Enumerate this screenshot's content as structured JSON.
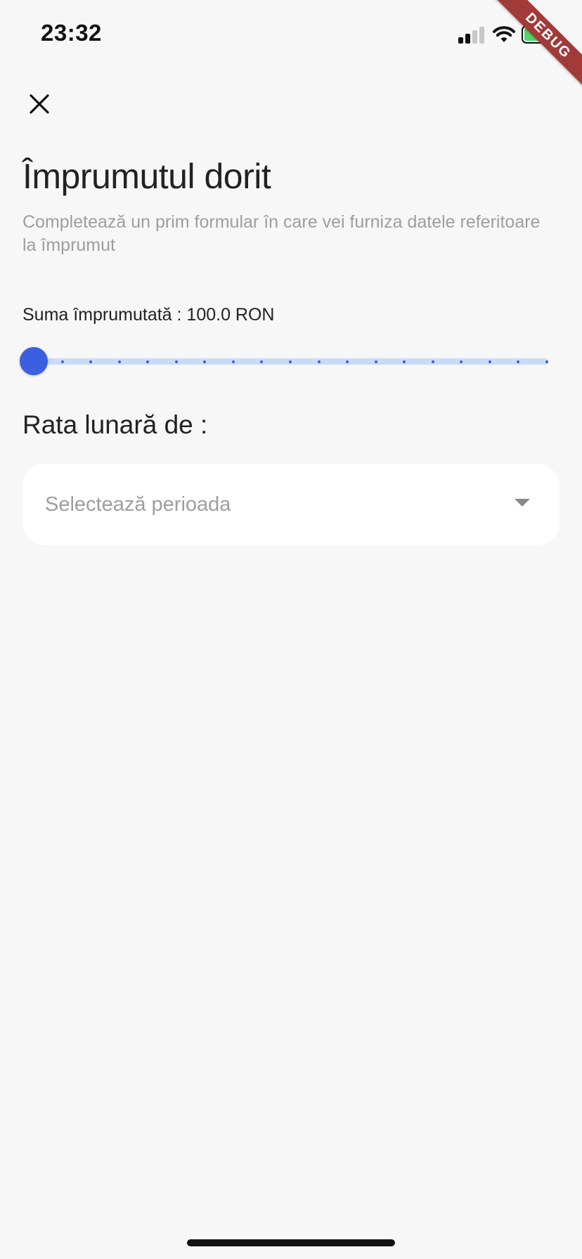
{
  "status_bar": {
    "time": "23:32",
    "battery_color": "#4cd964"
  },
  "debug_banner": {
    "label": "DEBUG",
    "color": "#a23a3a"
  },
  "header": {
    "close_icon": "close-icon"
  },
  "title": "Împrumutul dorit",
  "subtitle": "Completează un prim formular în care vei furniza datele referitoare la împrumut",
  "amount": {
    "label": "Suma împrumutată : 100.0 RON",
    "slider_fraction": 0.0,
    "divisions": 18,
    "accent": "#3b5fe0",
    "track_color": "#c9dcf5"
  },
  "rate": {
    "label": "Rata lunară de :",
    "select_placeholder": "Selectează perioada",
    "select_icon": "dropdown-arrow-icon"
  },
  "colors": {
    "background": "#f7f7f7",
    "text": "#222222",
    "muted": "#9e9e9e"
  }
}
